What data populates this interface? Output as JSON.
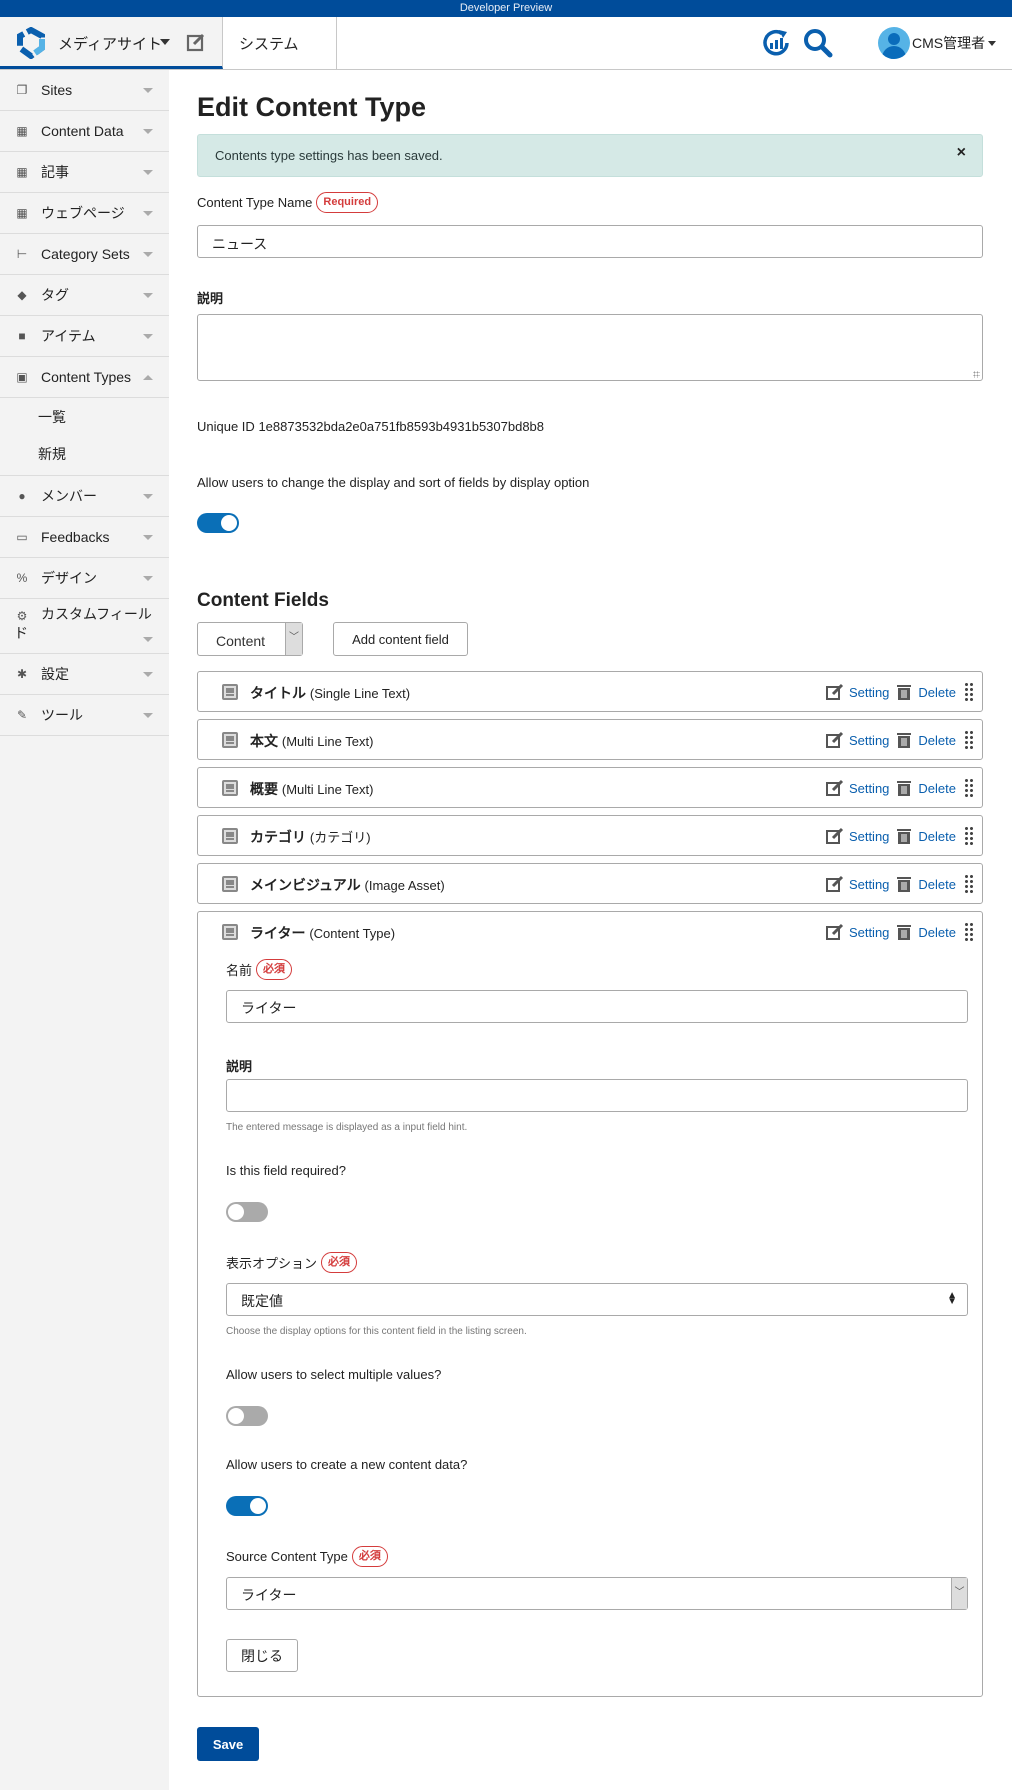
{
  "devbar": {
    "label": "Developer Preview"
  },
  "header": {
    "site_name": "メディアサイト",
    "system_tab": "システム",
    "user_name": "CMS管理者",
    "icons": [
      "logo-icon",
      "edit-site-icon",
      "sync-stats-icon",
      "search-icon",
      "user-avatar-icon"
    ]
  },
  "sidebar": {
    "items": [
      {
        "label": "Sites",
        "icon": "sites-icon",
        "expanded": false
      },
      {
        "label": "Content Data",
        "icon": "content-data-icon",
        "expanded": false
      },
      {
        "label": "記事",
        "icon": "entries-icon",
        "expanded": false
      },
      {
        "label": "ウェブページ",
        "icon": "pages-icon",
        "expanded": false
      },
      {
        "label": "Category Sets",
        "icon": "category-sets-icon",
        "expanded": false
      },
      {
        "label": "タグ",
        "icon": "tag-icon",
        "expanded": false
      },
      {
        "label": "アイテム",
        "icon": "briefcase-icon",
        "expanded": false
      },
      {
        "label": "Content Types",
        "icon": "content-types-icon",
        "expanded": true,
        "children": [
          "一覧",
          "新規"
        ]
      },
      {
        "label": "メンバー",
        "icon": "member-icon",
        "expanded": false
      },
      {
        "label": "Feedbacks",
        "icon": "feedback-icon",
        "expanded": false
      },
      {
        "label": "デザイン",
        "icon": "design-icon",
        "expanded": false
      },
      {
        "label": "カスタムフィールド",
        "icon": "custom-fields-icon",
        "expanded": false
      },
      {
        "label": "設定",
        "icon": "settings-icon",
        "expanded": false
      },
      {
        "label": "ツール",
        "icon": "tools-icon",
        "expanded": false
      }
    ]
  },
  "main": {
    "title": "Edit Content Type",
    "alert": {
      "message": "Contents type settings has been saved.",
      "close": "×"
    },
    "name_label": "Content Type Name",
    "required_badge": "Required",
    "name_value": "ニュース",
    "description_label": "説明",
    "description_value": "",
    "unique_id_label": "Unique ID",
    "unique_id": "1e8873532bda2e0a751fb8593b4931b5307bd8b8",
    "display_option_label": "Allow users to change the display and sort of fields by display option",
    "display_option_enabled": true,
    "content_fields_heading": "Content Fields",
    "field_type_select": "Content",
    "add_field_button": "Add content field",
    "setting_label": "Setting",
    "delete_label": "Delete",
    "fields": [
      {
        "name": "タイトル",
        "type": "(Single Line Text)"
      },
      {
        "name": "本文",
        "type": "(Multi Line Text)"
      },
      {
        "name": "概要",
        "type": "(Multi Line Text)"
      },
      {
        "name": "カテゴリ",
        "type": "(カテゴリ)"
      },
      {
        "name": "メインビジュアル",
        "type": "(Image Asset)"
      },
      {
        "name": "ライター",
        "type": "(Content Type)"
      }
    ],
    "expanded_field": {
      "name_label": "名前",
      "required_badge": "必須",
      "name_value": "ライター",
      "description_label": "説明",
      "description_value": "",
      "description_hint": "The entered message is displayed as a input field hint.",
      "required_question": "Is this field required?",
      "required_enabled": false,
      "display_option_label": "表示オプション",
      "display_option_value": "既定値",
      "display_option_hint": "Choose the display options for this content field in the listing screen.",
      "multiple_label": "Allow users to select multiple values?",
      "multiple_enabled": false,
      "create_new_label": "Allow users to create a new content data?",
      "create_new_enabled": true,
      "source_label": "Source Content Type",
      "source_value": "ライター",
      "close_button": "閉じる"
    },
    "save_button": "Save"
  }
}
